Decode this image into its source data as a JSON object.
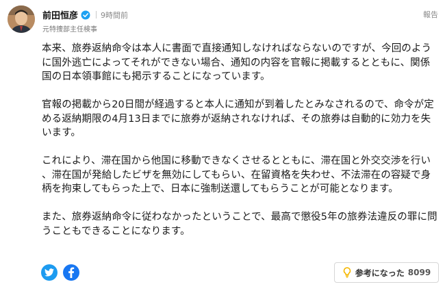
{
  "author": {
    "name": "前田恒彦",
    "title": "元特捜部主任検事",
    "timestamp": "9時間前",
    "verified_color": "#1da1f2"
  },
  "report_label": "報告",
  "paragraphs": [
    "本来、旅券返納命令は本人に書面で直接通知しなければならないのですが、今回のように国外逃亡によってそれができない場合、通知の内容を官報に掲載するとともに、関係国の日本領事館にも掲示することになっています。",
    "官報の掲載から20日間が経過すると本人に通知が到着したとみなされるので、命令が定める返納期限の4月13日までに旅券が返納されなければ、その旅券は自動的に効力を失います。",
    "これにより、滞在国から他国に移動できなくさせるとともに、滞在国と外交交渉を行い、滞在国が発給したビザを無効にしてもらい、在留資格を失わせ、不法滞在の容疑で身柄を拘束してもらった上で、日本に強制送還してもらうことが可能となります。",
    "また、旅券返納命令に従わなかったということで、最高で懲役5年の旅券法違反の罪に問うこともできることになります。"
  ],
  "share": {
    "twitter_icon": "twitter-icon",
    "facebook_icon": "facebook-icon",
    "twitter_color": "#1d9bf0",
    "facebook_color": "#1877f2"
  },
  "helpful": {
    "label": "参考になった",
    "count": "8099",
    "icon": "lightbulb-icon",
    "icon_color": "#f5b700"
  }
}
